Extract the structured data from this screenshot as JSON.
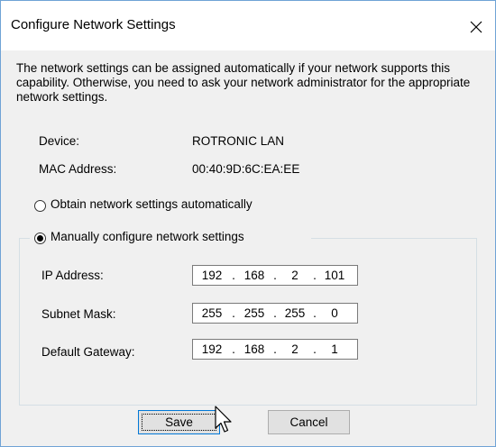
{
  "window": {
    "title": "Configure Network Settings",
    "close_icon": "close-icon"
  },
  "description": "The network settings can be assigned automatically if your network supports this capability. Otherwise, you need to ask your network administrator for the appropriate network settings.",
  "device": {
    "label": "Device:",
    "value": "ROTRONIC LAN"
  },
  "mac": {
    "label": "MAC Address:",
    "value": "00:40:9D:6C:EA:EE"
  },
  "options": {
    "auto_label": "Obtain network settings automatically",
    "manual_label": "Manually configure network settings",
    "selected": "manual"
  },
  "fields": [
    {
      "label": "IP Address:",
      "octets": [
        "192",
        "168",
        "2",
        "101"
      ]
    },
    {
      "label": "Subnet Mask:",
      "octets": [
        "255",
        "255",
        "255",
        "0"
      ]
    },
    {
      "label": "Default Gateway:",
      "octets": [
        "192",
        "168",
        "2",
        "1"
      ]
    }
  ],
  "buttons": {
    "save": "Save",
    "cancel": "Cancel"
  },
  "colors": {
    "window_border": "#6fa3d6",
    "button_focus": "#0078d7"
  }
}
